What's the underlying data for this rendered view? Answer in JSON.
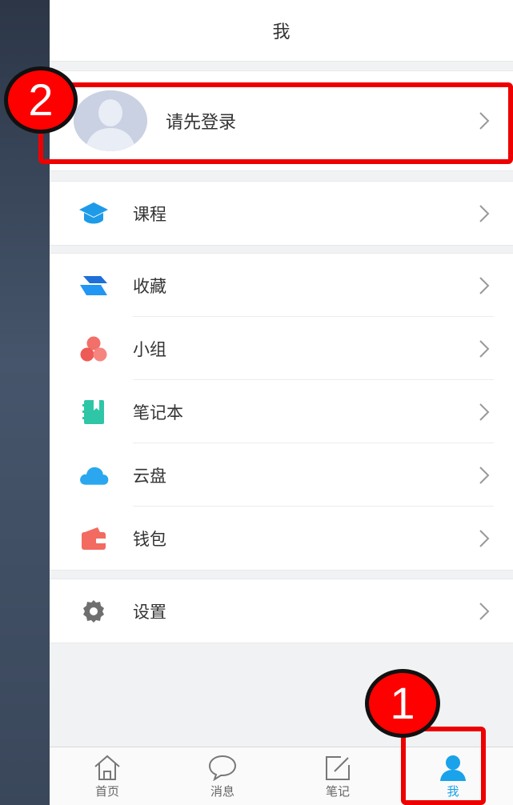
{
  "header": {
    "title": "我"
  },
  "profile": {
    "login_label": "请先登录"
  },
  "menu": {
    "course": "课程",
    "collection": "收藏",
    "group": "小组",
    "notebook": "笔记本",
    "cloud": "云盘",
    "wallet": "钱包",
    "settings": "设置"
  },
  "tabs": [
    {
      "label": "首页",
      "icon": "home-icon"
    },
    {
      "label": "消息",
      "icon": "message-icon"
    },
    {
      "label": "笔记",
      "icon": "note-edit-icon"
    },
    {
      "label": "我",
      "icon": "user-icon",
      "active": true
    }
  ],
  "annotations": {
    "callout_1": "1",
    "callout_2": "2"
  },
  "colors": {
    "accent": "#1aa2ea",
    "highlight": "#ee0000"
  }
}
